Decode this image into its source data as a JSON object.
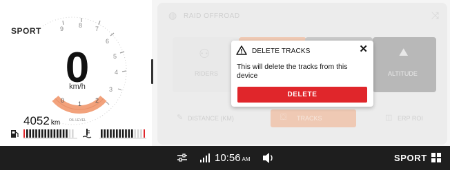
{
  "cluster": {
    "mode": "SPORT",
    "speed": "0",
    "speed_unit": "km/h",
    "odometer": "4052",
    "odometer_unit": "km",
    "odometer_sublabel": "OIL LEVEL",
    "tach_labels": [
      "9",
      "8",
      "7",
      "6",
      "5",
      "4",
      "3",
      "2",
      "1",
      "0"
    ],
    "fuel_level": 0.85,
    "coolant_level": 0.8
  },
  "panel": {
    "title": "RAID OFFROAD",
    "tiles": [
      "RIDERS",
      "ALTITUDE"
    ],
    "bottom_items": [
      "DISTANCE (KM)",
      "TRACKS",
      "ERP ROI"
    ]
  },
  "dialog": {
    "title": "DELETE TRACKS",
    "close_symbol": "✕",
    "message": "This will delete the tracks from this device",
    "button_label": "DELETE",
    "accent": "#e0262b"
  },
  "statusbar": {
    "time": "10:56",
    "ampm": "AM",
    "mode": "SPORT",
    "icons": [
      "settings-sliders-icon",
      "signal-bars-icon",
      "volume-icon",
      "grid-menu-icon"
    ]
  }
}
